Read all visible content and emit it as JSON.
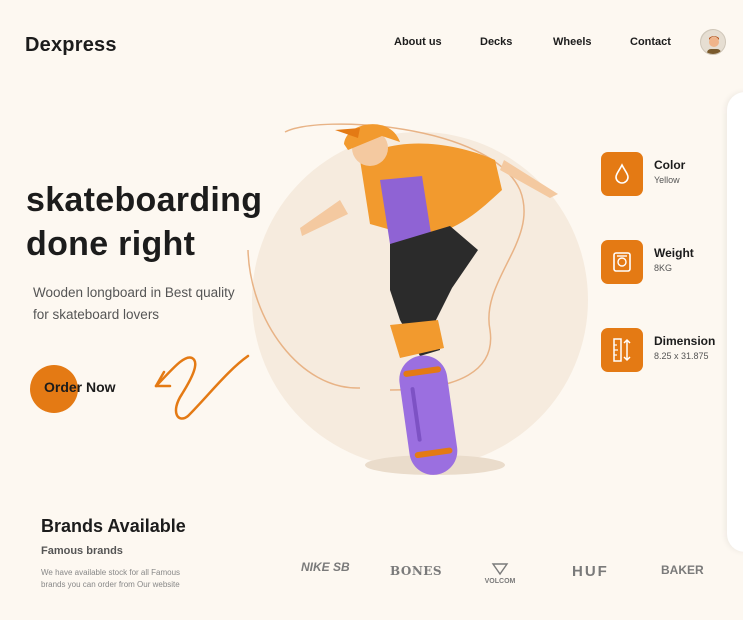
{
  "header": {
    "logo": "Dexpress",
    "nav": [
      "About us",
      "Decks",
      "Wheels",
      "Contact"
    ]
  },
  "hero": {
    "title_line1": "skateboarding",
    "title_line2": "done right",
    "subtitle": "Wooden longboard in Best quality for skateboard lovers",
    "cta": "Order Now"
  },
  "specs": [
    {
      "label": "Color",
      "value": "Yellow",
      "icon": "drop-icon"
    },
    {
      "label": "Weight",
      "value": "8KG",
      "icon": "scale-icon"
    },
    {
      "label": "Dimension",
      "value": "8.25 x 31.875",
      "icon": "ruler-icon"
    }
  ],
  "brands": {
    "title": "Brands Available",
    "subtitle": "Famous brands",
    "description": "We have available stock for all Famous brands you can order from Our website",
    "logos": [
      "NIKE SB",
      "BONES",
      "VOLCOM",
      "HUF",
      "BAKER"
    ]
  },
  "colors": {
    "accent": "#e47a14",
    "background": "#fdf8f1",
    "deck": "#9b6fe0"
  }
}
